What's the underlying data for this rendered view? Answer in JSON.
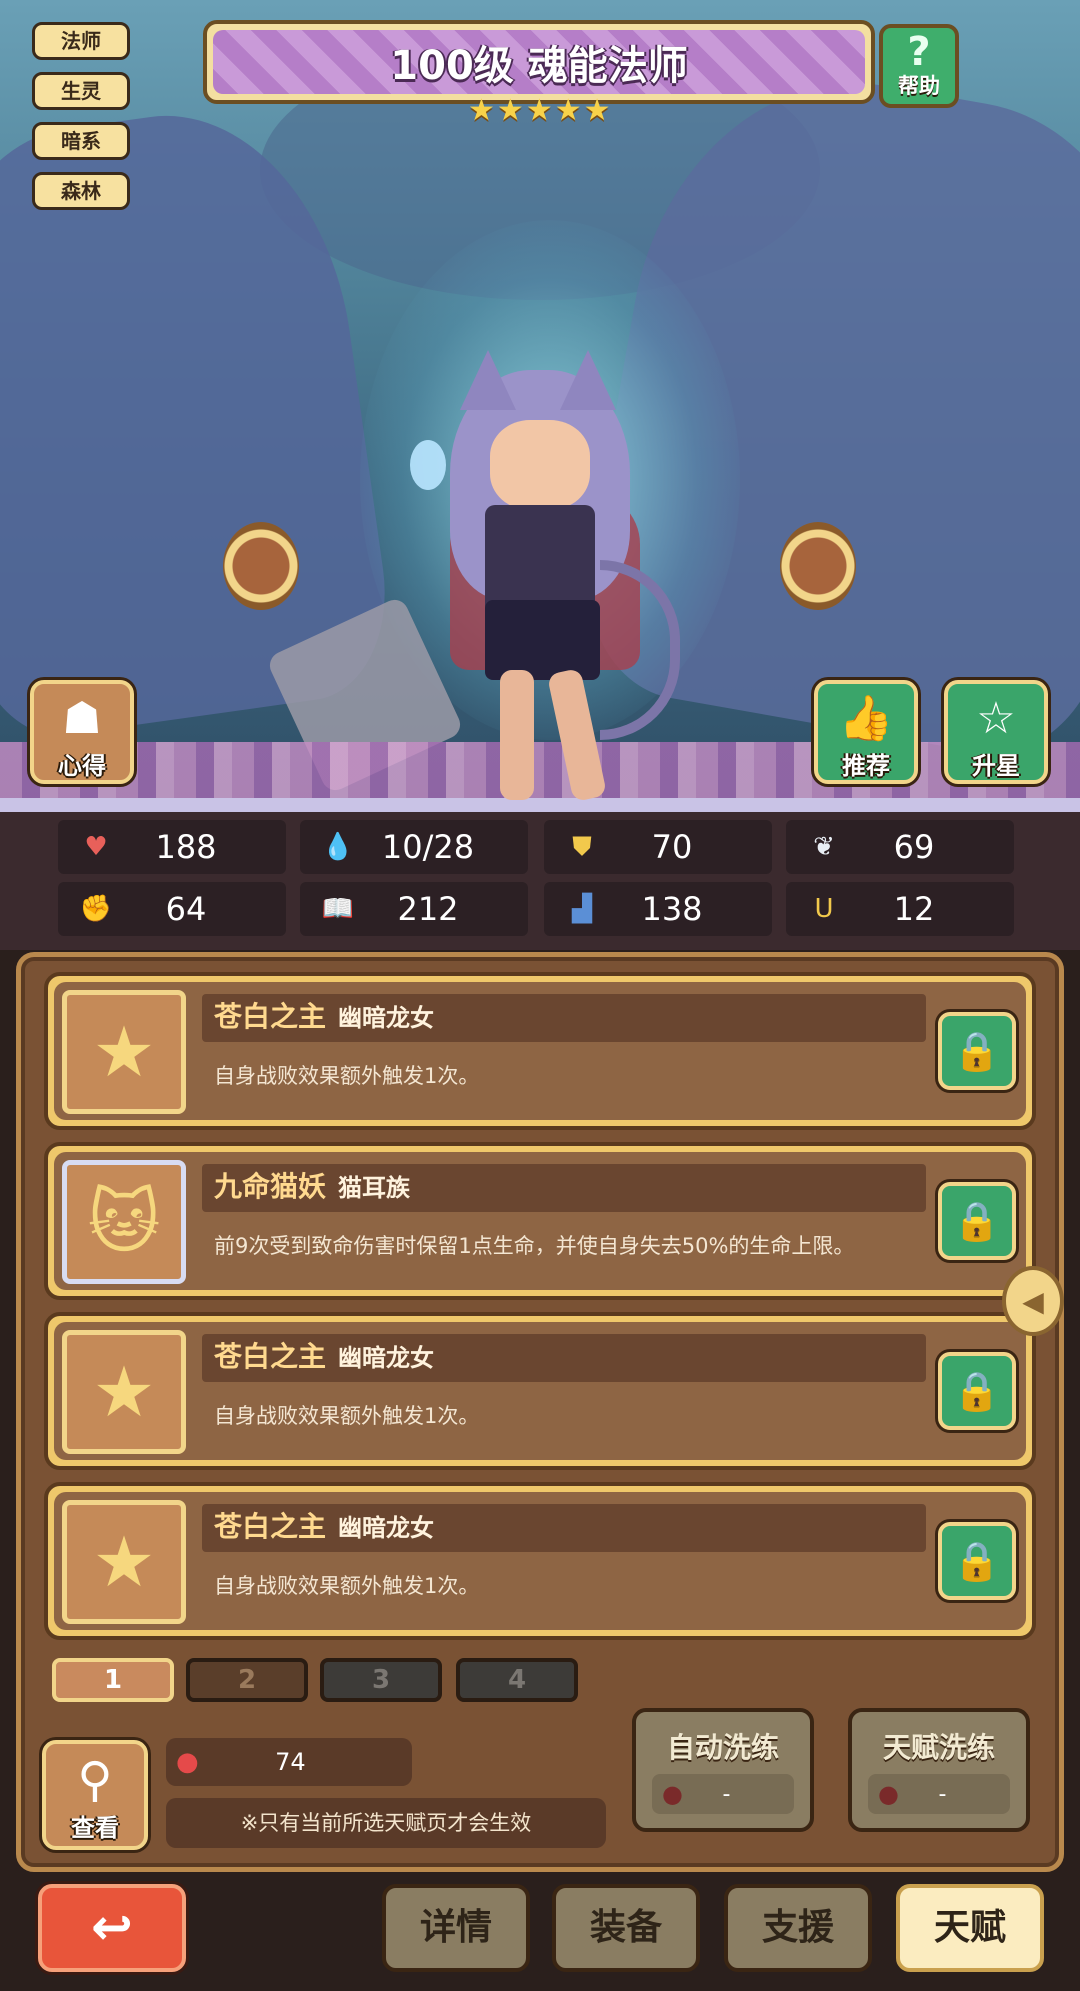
{
  "tags": [
    "法师",
    "生灵",
    "暗系",
    "森林"
  ],
  "header": {
    "title": "100级 魂能法师",
    "stars": [
      "★",
      "★",
      "★",
      "★",
      "★"
    ],
    "help_label": "帮助",
    "help_icon": "?"
  },
  "side": {
    "notes_label": "心得",
    "recommend_label": "推荐",
    "upgrade_label": "升星"
  },
  "stats": [
    {
      "icon": "heart-icon",
      "glyph": "♥",
      "color": "#e8605a",
      "value": "188"
    },
    {
      "icon": "mana-drop-icon",
      "glyph": "💧",
      "color": "#6ec3ef",
      "value": "10/28"
    },
    {
      "icon": "shield-icon",
      "glyph": "⛊",
      "color": "#f2c94c",
      "value": "70"
    },
    {
      "icon": "wing-icon",
      "glyph": "❦",
      "color": "#e9eef5",
      "value": "69"
    },
    {
      "icon": "fist-icon",
      "glyph": "✊",
      "color": "#f0a98a",
      "value": "64"
    },
    {
      "icon": "book-icon",
      "glyph": "📖",
      "color": "#e85a4a",
      "value": "212"
    },
    {
      "icon": "boot-icon",
      "glyph": "▟",
      "color": "#5b8fd6",
      "value": "138"
    },
    {
      "icon": "horseshoe-icon",
      "glyph": "Ս",
      "color": "#f2c94c",
      "value": "12"
    }
  ],
  "talents": [
    {
      "icon": "star-icon",
      "name": "苍白之主",
      "sub": "幽暗龙女",
      "desc": "自身战败效果额外触发1次。"
    },
    {
      "icon": "cat-icon",
      "name": "九命猫妖",
      "sub": "猫耳族",
      "desc": "前9次受到致命伤害时保留1点生命，并使自身失去50%的生命上限。"
    },
    {
      "icon": "star-icon",
      "name": "苍白之主",
      "sub": "幽暗龙女",
      "desc": "自身战败效果额外触发1次。"
    },
    {
      "icon": "star-icon",
      "name": "苍白之主",
      "sub": "幽暗龙女",
      "desc": "自身战败效果额外触发1次。"
    }
  ],
  "pages": [
    "1",
    "2",
    "3",
    "4"
  ],
  "bottom": {
    "view_label": "查看",
    "fruit_count": "74",
    "note": "※只有当前所选天赋页才会生效",
    "auto_wash": {
      "label": "自动洗练",
      "value": "-"
    },
    "talent_wash": {
      "label": "天赋洗练",
      "value": "-"
    }
  },
  "nav": {
    "details": "详情",
    "equip": "装备",
    "support": "支援",
    "talent": "天赋",
    "active": "talent"
  },
  "colors": {
    "panel": "#7a5234",
    "gold": "#f2d58a",
    "green": "#3aa56a",
    "back": "#e8553a"
  }
}
